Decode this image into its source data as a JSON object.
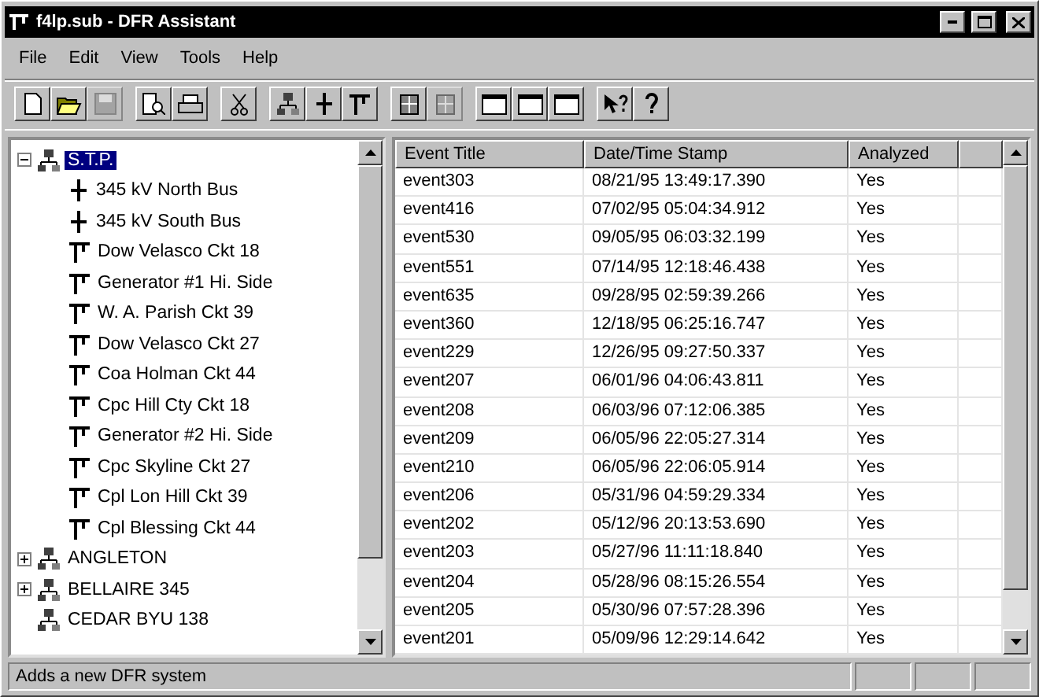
{
  "window": {
    "title": "f4lp.sub - DFR Assistant"
  },
  "menu": [
    "File",
    "Edit",
    "View",
    "Tools",
    "Help"
  ],
  "toolbar": [
    [
      {
        "kind": "new",
        "disabled": false
      },
      {
        "kind": "open",
        "disabled": false
      },
      {
        "kind": "save",
        "disabled": true
      }
    ],
    [
      {
        "kind": "preview",
        "disabled": false
      },
      {
        "kind": "print",
        "disabled": false
      }
    ],
    [
      {
        "kind": "cut",
        "disabled": false
      }
    ],
    [
      {
        "kind": "system",
        "disabled": false
      },
      {
        "kind": "bus",
        "disabled": false
      },
      {
        "kind": "breaker",
        "disabled": false
      }
    ],
    [
      {
        "kind": "grid",
        "disabled": false
      },
      {
        "kind": "grid",
        "disabled": true
      }
    ],
    [
      {
        "kind": "window",
        "disabled": false
      },
      {
        "kind": "window",
        "disabled": false
      },
      {
        "kind": "window",
        "disabled": false
      }
    ],
    [
      {
        "kind": "whatsthis",
        "disabled": false
      },
      {
        "kind": "help",
        "disabled": false
      }
    ]
  ],
  "tree": [
    {
      "label": "S.T.P.",
      "kind": "system",
      "selected": true,
      "expandable": true,
      "expanded": true,
      "children": [
        {
          "label": "345 kV North Bus",
          "kind": "bus",
          "selected": false
        },
        {
          "label": "345 kV South Bus",
          "kind": "bus",
          "selected": false
        },
        {
          "label": "Dow Velasco Ckt 18",
          "kind": "breaker",
          "selected": false
        },
        {
          "label": "Generator #1 Hi. Side",
          "kind": "breaker",
          "selected": false
        },
        {
          "label": "W. A. Parish Ckt 39",
          "kind": "breaker",
          "selected": false
        },
        {
          "label": "Dow Velasco Ckt 27",
          "kind": "breaker",
          "selected": false
        },
        {
          "label": "Coa Holman Ckt 44",
          "kind": "breaker",
          "selected": false
        },
        {
          "label": "Cpc Hill Cty Ckt 18",
          "kind": "breaker",
          "selected": false
        },
        {
          "label": "Generator #2 Hi. Side",
          "kind": "breaker",
          "selected": false
        },
        {
          "label": "Cpc Skyline Ckt 27",
          "kind": "breaker",
          "selected": false
        },
        {
          "label": "Cpl Lon Hill Ckt 39",
          "kind": "breaker",
          "selected": false
        },
        {
          "label": "Cpl Blessing Ckt 44",
          "kind": "breaker",
          "selected": false
        }
      ]
    },
    {
      "label": "ANGLETON",
      "kind": "system",
      "selected": false,
      "expandable": true,
      "expanded": false
    },
    {
      "label": "BELLAIRE 345",
      "kind": "system",
      "selected": false,
      "expandable": true,
      "expanded": false
    },
    {
      "label": "CEDAR BYU 138",
      "kind": "system",
      "selected": false,
      "expandable": false,
      "expanded": false
    }
  ],
  "table": {
    "columns": [
      "Event Title",
      "Date/Time Stamp",
      "Analyzed"
    ],
    "rows": [
      [
        "event303",
        "08/21/95  13:49:17.390",
        "Yes"
      ],
      [
        "event416",
        "07/02/95  05:04:34.912",
        "Yes"
      ],
      [
        "event530",
        "09/05/95  06:03:32.199",
        "Yes"
      ],
      [
        "event551",
        "07/14/95  12:18:46.438",
        "Yes"
      ],
      [
        "event635",
        "09/28/95  02:59:39.266",
        "Yes"
      ],
      [
        "event360",
        "12/18/95  06:25:16.747",
        "Yes"
      ],
      [
        "event229",
        "12/26/95  09:27:50.337",
        "Yes"
      ],
      [
        "event207",
        "06/01/96  04:06:43.811",
        "Yes"
      ],
      [
        "event208",
        "06/03/96  07:12:06.385",
        "Yes"
      ],
      [
        "event209",
        "06/05/96  22:05:27.314",
        "Yes"
      ],
      [
        "event210",
        "06/05/96  22:06:05.914",
        "Yes"
      ],
      [
        "event206",
        "05/31/96  04:59:29.334",
        "Yes"
      ],
      [
        "event202",
        "05/12/96  20:13:53.690",
        "Yes"
      ],
      [
        "event203",
        "05/27/96  11:11:18.840",
        "Yes"
      ],
      [
        "event204",
        "05/28/96  08:15:26.554",
        "Yes"
      ],
      [
        "event205",
        "05/30/96  07:57:28.396",
        "Yes"
      ],
      [
        "event201",
        "05/09/96  12:29:14.642",
        "Yes"
      ]
    ]
  },
  "status_bar": {
    "message": "Adds a new DFR system"
  }
}
